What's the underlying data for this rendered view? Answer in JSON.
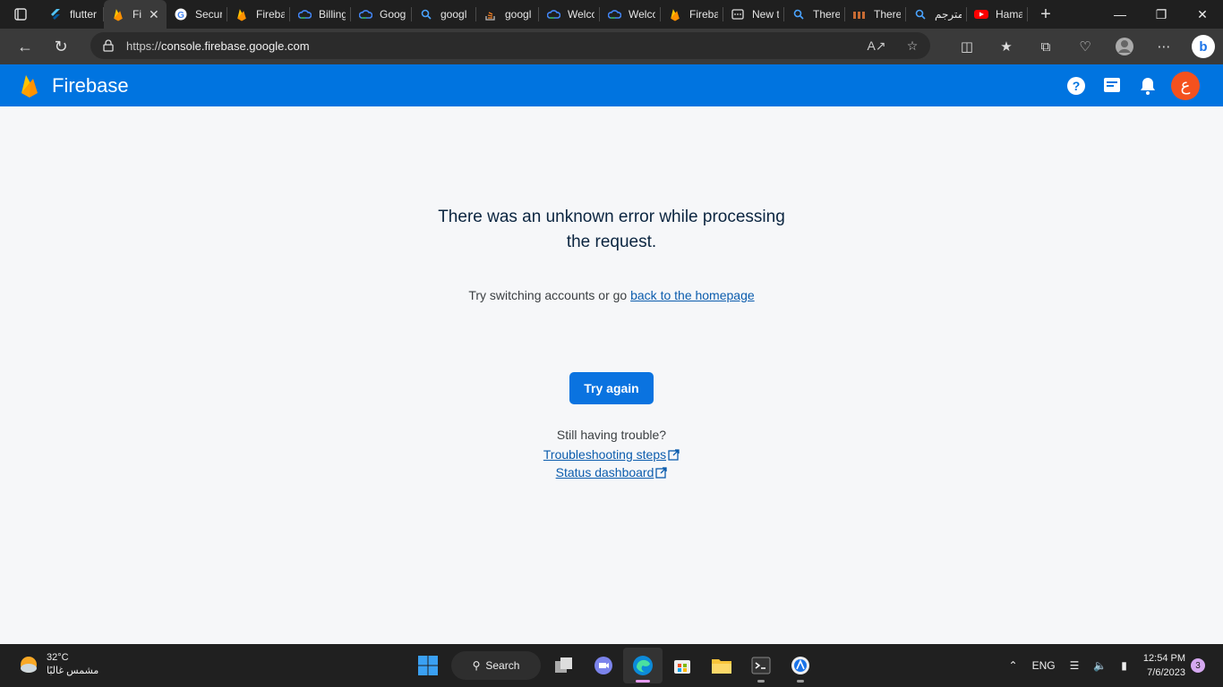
{
  "browser": {
    "tabs": [
      {
        "title": "flutter",
        "icon": "flutter-icon",
        "active": false
      },
      {
        "title": "Fi",
        "icon": "firebase-icon",
        "active": true
      },
      {
        "title": "Securi",
        "icon": "google-icon",
        "active": false
      },
      {
        "title": "Fireba",
        "icon": "firebase-icon",
        "active": false
      },
      {
        "title": "Billing",
        "icon": "google-cloud-icon",
        "active": false
      },
      {
        "title": "Googl",
        "icon": "google-cloud-icon",
        "active": false
      },
      {
        "title": "googl",
        "icon": "search-icon",
        "active": false
      },
      {
        "title": "googl",
        "icon": "stackoverflow-icon",
        "active": false
      },
      {
        "title": "Welco",
        "icon": "google-cloud-icon",
        "active": false
      },
      {
        "title": "Welco",
        "icon": "google-cloud-icon",
        "active": false
      },
      {
        "title": "Fireba",
        "icon": "firebase-icon",
        "active": false
      },
      {
        "title": "New t",
        "icon": "new-tab-icon",
        "active": false
      },
      {
        "title": "There",
        "icon": "search-icon",
        "active": false
      },
      {
        "title": "There",
        "icon": "site-icon",
        "active": false
      },
      {
        "title": "مترجم",
        "icon": "search-icon",
        "active": false
      },
      {
        "title": "Hama",
        "icon": "youtube-icon",
        "active": false
      }
    ],
    "url_prefix": "https://",
    "url_host": "console.firebase.google.com"
  },
  "header": {
    "brand": "Firebase",
    "avatar_letter": "ع"
  },
  "main": {
    "error_title": "There was an unknown error while processing the request.",
    "sub_text": "Try switching accounts or go ",
    "sub_link": "back to the homepage",
    "button_label": "Try again",
    "trouble_text": "Still having trouble?",
    "link_troubleshooting": "Troubleshooting steps",
    "link_status": "Status dashboard"
  },
  "taskbar": {
    "temperature": "32°C",
    "weather_desc": "مشمس غالبًا",
    "search_label": "Search",
    "language": "ENG",
    "time": "12:54 PM",
    "date": "7/6/2023",
    "notifications": "3"
  },
  "colors": {
    "firebase_blue": "#0074e0",
    "button_blue": "#0a73e0",
    "avatar_orange": "#f4511e"
  }
}
